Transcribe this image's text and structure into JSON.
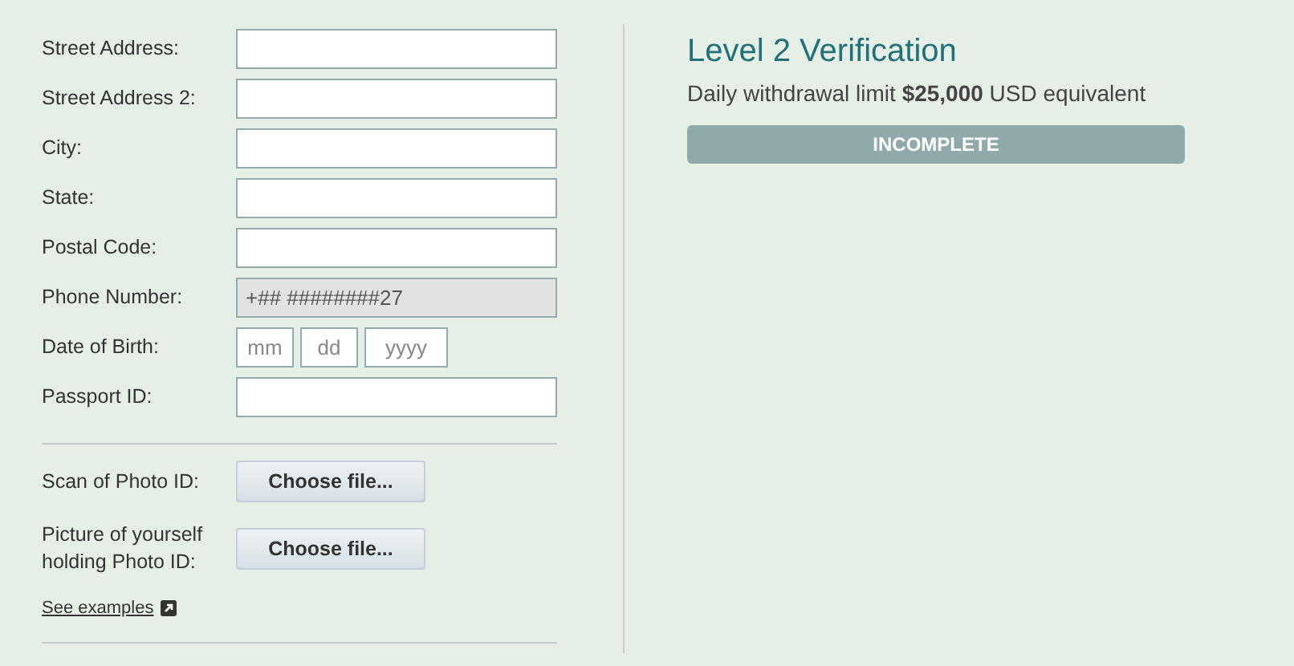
{
  "form": {
    "fields": [
      {
        "kind": "text",
        "label": "Street Address:",
        "disabled": false
      },
      {
        "kind": "text",
        "label": "Street Address 2:",
        "disabled": false
      },
      {
        "kind": "text",
        "label": "City:",
        "disabled": false
      },
      {
        "kind": "text",
        "label": "State:",
        "disabled": false
      },
      {
        "kind": "text",
        "label": "Postal Code:",
        "disabled": false
      },
      {
        "kind": "text",
        "label": "Phone Number:",
        "value": "+## ########27",
        "disabled": true
      },
      {
        "kind": "date",
        "label": "Date of Birth:",
        "parts": [
          {
            "placeholder": "mm"
          },
          {
            "placeholder": "dd"
          },
          {
            "placeholder": "yyyy"
          }
        ]
      },
      {
        "kind": "text",
        "label": "Passport ID:",
        "disabled": false
      }
    ],
    "uploads": [
      {
        "label": "Scan of Photo ID:",
        "button": "Choose file..."
      },
      {
        "label": "Picture of yourself holding Photo ID:",
        "button": "Choose file..."
      }
    ],
    "link": "See examples"
  },
  "verification": {
    "title": "Level 2 Verification",
    "description": "Daily withdrawal limit **$25,000** USD equivalent",
    "status": {
      "label": "INCOMPLETE",
      "kind": "incomplete"
    }
  }
}
